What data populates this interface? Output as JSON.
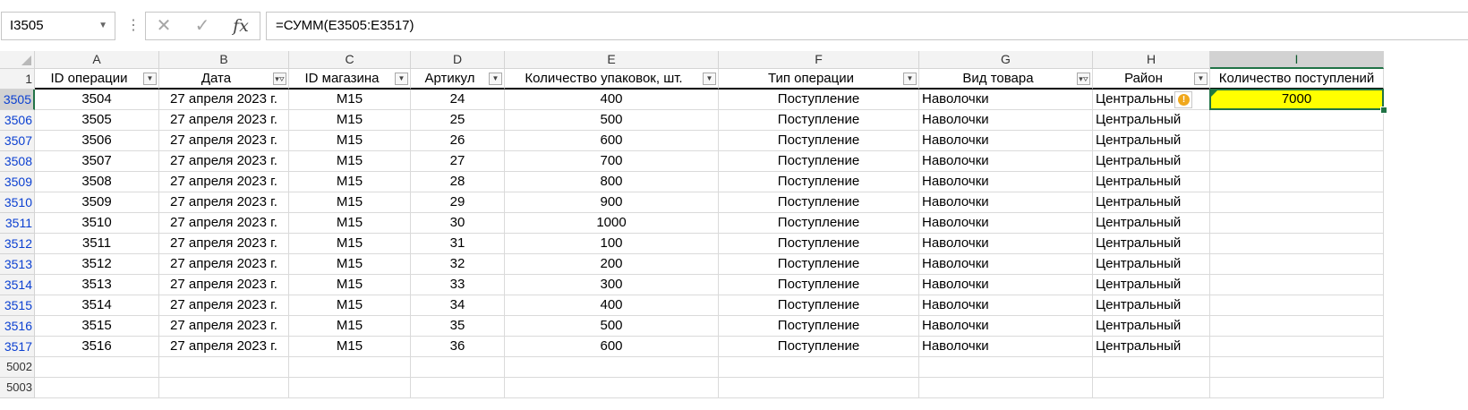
{
  "formula_bar": {
    "name_box": "I3505",
    "formula": "=СУММ(E3505:E3517)",
    "cancel_icon": "close-icon",
    "enter_icon": "check-icon",
    "function_icon": "fx-icon"
  },
  "columns": [
    {
      "letter": "A",
      "header": "ID операции",
      "filter": "dropdown",
      "align": "c"
    },
    {
      "letter": "B",
      "header": "Дата",
      "filter": "filtered",
      "align": "c"
    },
    {
      "letter": "C",
      "header": "ID магазина",
      "filter": "dropdown",
      "align": "c"
    },
    {
      "letter": "D",
      "header": "Артикул",
      "filter": "dropdown",
      "align": "c"
    },
    {
      "letter": "E",
      "header": "Количество упаковок, шт.",
      "filter": "dropdown",
      "align": "c"
    },
    {
      "letter": "F",
      "header": "Тип операции",
      "filter": "dropdown",
      "align": "c"
    },
    {
      "letter": "G",
      "header": "Вид товара",
      "filter": "filtered",
      "align": "l"
    },
    {
      "letter": "H",
      "header": "Район",
      "filter": "dropdown",
      "align": "l"
    },
    {
      "letter": "I",
      "header": "Количество поступлений",
      "filter": "",
      "align": "c"
    }
  ],
  "header_row_number": "1",
  "rows": [
    {
      "num": "3505",
      "cells": [
        "3504",
        "27 апреля 2023 г.",
        "M15",
        "24",
        "400",
        "Поступление",
        "Наволочки",
        "Центральный",
        "7000"
      ]
    },
    {
      "num": "3506",
      "cells": [
        "3505",
        "27 апреля 2023 г.",
        "M15",
        "25",
        "500",
        "Поступление",
        "Наволочки",
        "Центральный",
        ""
      ]
    },
    {
      "num": "3507",
      "cells": [
        "3506",
        "27 апреля 2023 г.",
        "M15",
        "26",
        "600",
        "Поступление",
        "Наволочки",
        "Центральный",
        ""
      ]
    },
    {
      "num": "3508",
      "cells": [
        "3507",
        "27 апреля 2023 г.",
        "M15",
        "27",
        "700",
        "Поступление",
        "Наволочки",
        "Центральный",
        ""
      ]
    },
    {
      "num": "3509",
      "cells": [
        "3508",
        "27 апреля 2023 г.",
        "M15",
        "28",
        "800",
        "Поступление",
        "Наволочки",
        "Центральный",
        ""
      ]
    },
    {
      "num": "3510",
      "cells": [
        "3509",
        "27 апреля 2023 г.",
        "M15",
        "29",
        "900",
        "Поступление",
        "Наволочки",
        "Центральный",
        ""
      ]
    },
    {
      "num": "3511",
      "cells": [
        "3510",
        "27 апреля 2023 г.",
        "M15",
        "30",
        "1000",
        "Поступление",
        "Наволочки",
        "Центральный",
        ""
      ]
    },
    {
      "num": "3512",
      "cells": [
        "3511",
        "27 апреля 2023 г.",
        "M15",
        "31",
        "100",
        "Поступление",
        "Наволочки",
        "Центральный",
        ""
      ]
    },
    {
      "num": "3513",
      "cells": [
        "3512",
        "27 апреля 2023 г.",
        "M15",
        "32",
        "200",
        "Поступление",
        "Наволочки",
        "Центральный",
        ""
      ]
    },
    {
      "num": "3514",
      "cells": [
        "3513",
        "27 апреля 2023 г.",
        "M15",
        "33",
        "300",
        "Поступление",
        "Наволочки",
        "Центральный",
        ""
      ]
    },
    {
      "num": "3515",
      "cells": [
        "3514",
        "27 апреля 2023 г.",
        "M15",
        "34",
        "400",
        "Поступление",
        "Наволочки",
        "Центральный",
        ""
      ]
    },
    {
      "num": "3516",
      "cells": [
        "3515",
        "27 апреля 2023 г.",
        "M15",
        "35",
        "500",
        "Поступление",
        "Наволочки",
        "Центральный",
        ""
      ]
    },
    {
      "num": "3517",
      "cells": [
        "3516",
        "27 апреля 2023 г.",
        "M15",
        "36",
        "600",
        "Поступление",
        "Наволочки",
        "Центральный",
        ""
      ]
    }
  ],
  "empty_rows": [
    "5002",
    "5003"
  ],
  "selected_cell": {
    "column": "I",
    "row": "3505",
    "fill": "#ffff00"
  },
  "warning_icon": "warning-icon",
  "colors": {
    "selection": "#217346",
    "filtered_row_number": "#0a3fd1"
  }
}
